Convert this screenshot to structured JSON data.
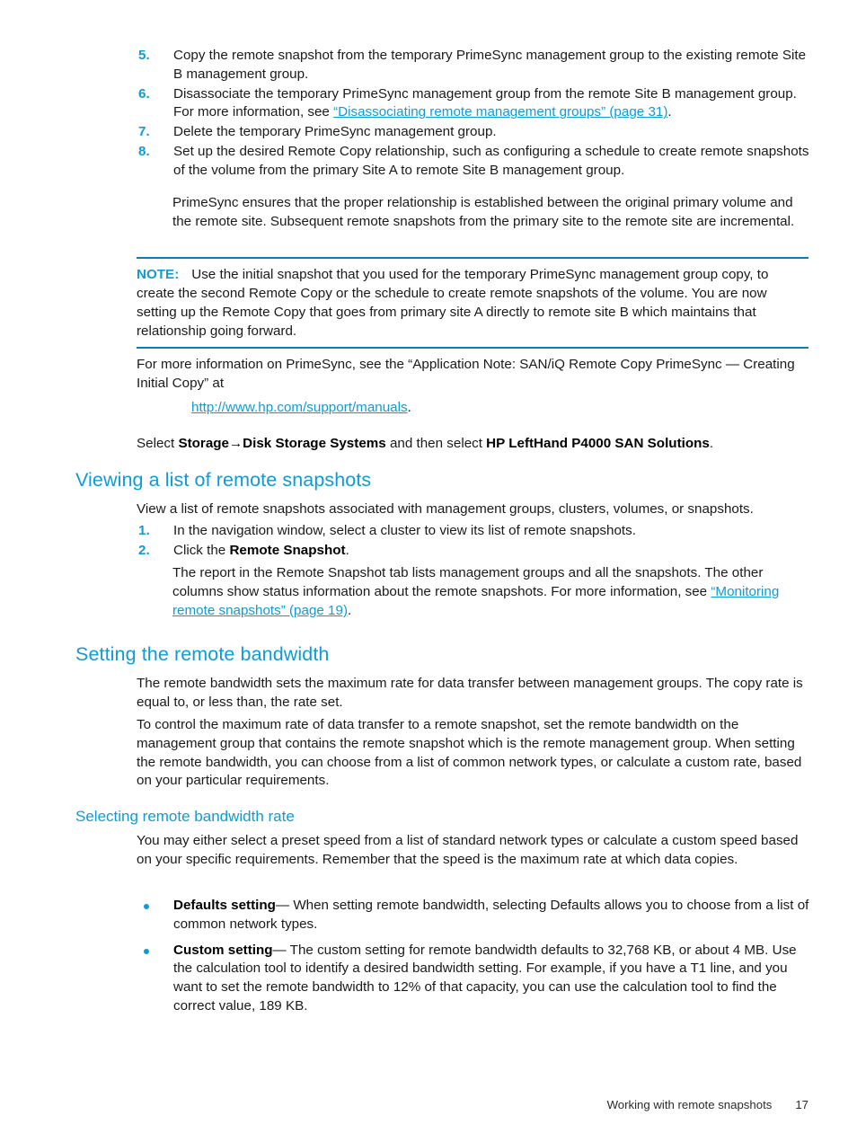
{
  "document": {
    "footer": {
      "chapter": "Working with remote snapshots",
      "page_number": "17"
    }
  },
  "colors": {
    "heading_blue": "#0f9bd7",
    "link_blue": "#0f9bd7",
    "rule_blue": "#0b7fb5",
    "body_text": "#1a1a1a"
  },
  "steps": {
    "items": [
      {
        "number": "5.",
        "text": "Copy the remote snapshot from the temporary PrimeSync management group to the existing remote Site B management group."
      },
      {
        "number": "6.",
        "text_before": "Disassociate the temporary PrimeSync management group from the remote Site B management group. For more information, see ",
        "link": "“Disassociating remote management groups” (page 31)",
        "text_after": "."
      },
      {
        "number": "7.",
        "text": "Delete the temporary PrimeSync management group."
      },
      {
        "number": "8.",
        "text": "Set up the desired Remote Copy relationship, such as configuring a schedule to create remote snapshots of the volume from the primary Site A to remote Site B management group."
      }
    ],
    "continuation_paragraph": "PrimeSync ensures that the proper relationship is established between the original primary volume and the remote site. Subsequent remote snapshots from the primary site to the remote site are incremental."
  },
  "note": {
    "label": "NOTE:",
    "text": "Use the initial snapshot that you used for the temporary PrimeSync management group copy, to create the second Remote Copy or the schedule to create remote snapshots of the volume. You are now setting up the Remote Copy that goes from primary site A directly to remote site B which maintains that relationship going forward."
  },
  "more_info": {
    "paragraph": "For more information on PrimeSync, see the “Application Note: SAN/iQ Remote Copy PrimeSync — Creating Initial Copy” at",
    "url": "http://www.hp.com/support/manuals",
    "url_suffix": ".",
    "select_line": {
      "prefix": "Select ",
      "bold1": "Storage→Disk Storage Systems",
      "middle": " and then select ",
      "bold2": "HP LeftHand P4000 SAN Solutions",
      "suffix": "."
    }
  },
  "section_viewing": {
    "heading": "Viewing a list of remote snapshots",
    "intro": "View a list of remote snapshots associated with management groups, clusters, volumes, or snapshots.",
    "steps": [
      {
        "number": "1.",
        "text": "In the navigation window, select a cluster to view its list of remote snapshots."
      },
      {
        "number": "2.",
        "text_before": "Click the ",
        "bold": "Remote Snapshot",
        "text_after": "."
      }
    ],
    "report_paragraph": {
      "text_before": "The report in the Remote Snapshot tab lists management groups and all the snapshots. The other columns show status information about the remote snapshots. For more information, see ",
      "link": "“Monitoring remote snapshots” (page 19)",
      "text_after": "."
    }
  },
  "section_setting": {
    "heading": "Setting the remote bandwidth",
    "paragraph_1": "The remote bandwidth sets the maximum rate for data transfer between management groups. The copy rate is equal to, or less than, the rate set.",
    "paragraph_2": "To control the maximum rate of data transfer to a remote snapshot, set the remote bandwidth on the management group that contains the remote snapshot which is the remote management group. When setting the remote bandwidth, you can choose from a list of common network types, or calculate a custom rate, based on your particular requirements."
  },
  "section_selecting": {
    "heading": "Selecting remote bandwidth rate",
    "paragraph_1": "You may either select a preset speed from a list of standard network types or calculate a custom speed based on your specific requirements. Remember that the speed is the maximum rate at which data copies.",
    "bullets": [
      {
        "bold": "Defaults setting",
        "text": "— When setting remote bandwidth, selecting Defaults allows you to choose from a list of common network types."
      },
      {
        "bold": "Custom setting",
        "text": "— The custom setting for remote bandwidth defaults to 32,768 KB, or about 4 MB. Use the calculation tool to identify a desired bandwidth setting. For example, if you have a T1 line, and you want to set the remote bandwidth to 12% of that capacity, you can use the calculation tool to find the correct value, 189 KB."
      }
    ]
  }
}
